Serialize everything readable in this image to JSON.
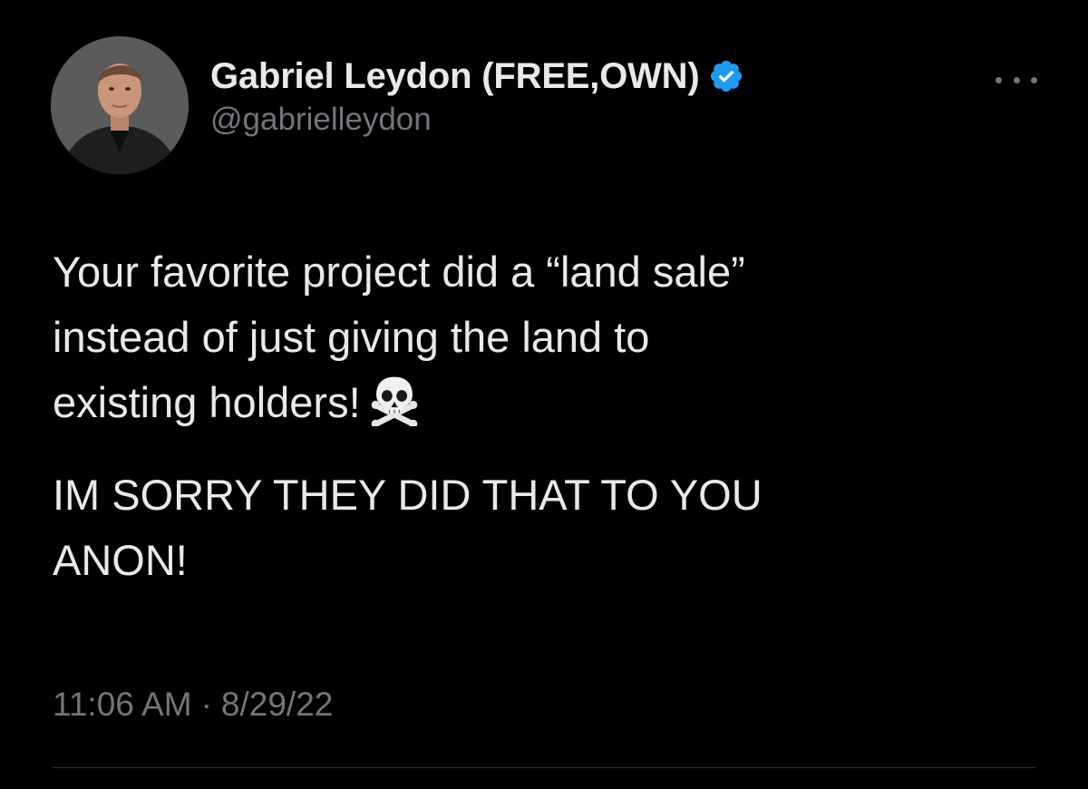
{
  "author": {
    "display_name": "Gabriel Leydon (FREE,OWN)",
    "handle": "@gabrielleydon",
    "verified_icon": "verified-badge-icon",
    "verified_color": "#1d9bf0",
    "avatar": "profile-photo"
  },
  "tweet": {
    "paragraph1_lines": [
      "Your favorite project did a “land sale”",
      "instead of just giving the land to",
      "existing holders!"
    ],
    "emoji": "skull-and-crossbones-icon",
    "paragraph2_lines": [
      "IM SORRY THEY DID THAT TO YOU",
      "ANON!"
    ]
  },
  "meta": {
    "time": "11:06 AM",
    "separator": "·",
    "date": "8/29/22"
  },
  "more_icon": "more-options-icon",
  "colors": {
    "background": "#000000",
    "text": "#e7e9ea",
    "secondary": "#71767b",
    "divider": "#2f3336"
  }
}
